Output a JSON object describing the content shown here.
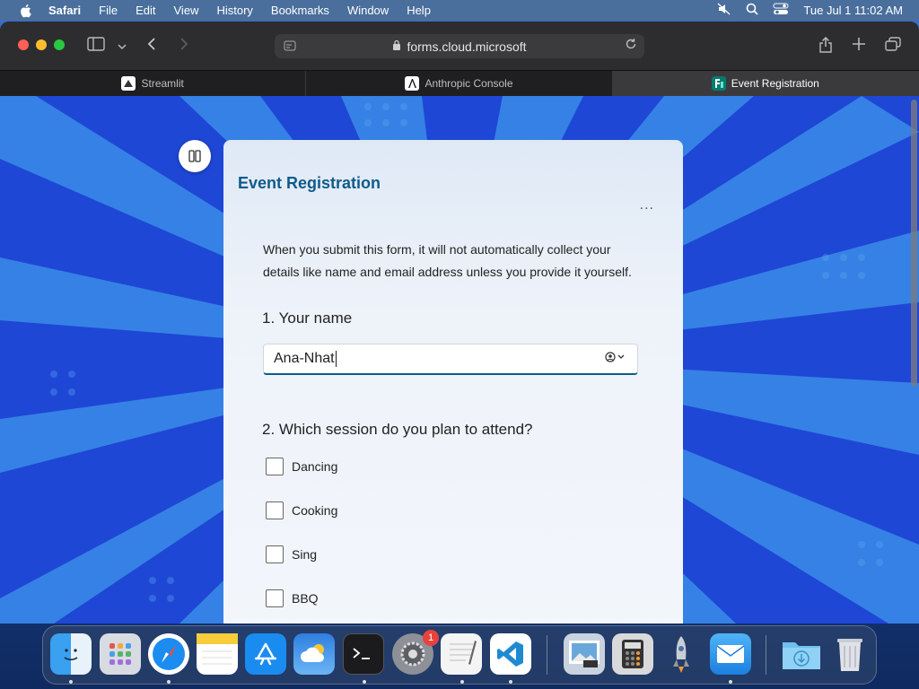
{
  "menubar": {
    "app_name": "Safari",
    "items": [
      "File",
      "Edit",
      "View",
      "History",
      "Bookmarks",
      "Window",
      "Help"
    ],
    "clock": "Tue Jul 1  11:02 AM"
  },
  "browser": {
    "url": "forms.cloud.microsoft",
    "tabs": [
      {
        "label": "Streamlit",
        "icon": "streamlit-icon"
      },
      {
        "label": "Anthropic Console",
        "icon": "anthropic-icon"
      },
      {
        "label": "Event Registration",
        "icon": "forms-icon"
      }
    ]
  },
  "form": {
    "title": "Event Registration",
    "more_label": "...",
    "description": "When you submit this form, it will not automatically collect your details like name and email address unless you provide it yourself.",
    "q1": {
      "number": "1.",
      "label": "Your name",
      "value": "Ana-Nhat"
    },
    "q2": {
      "number": "2.",
      "label": "Which session do you plan to attend?",
      "options": [
        "Dancing",
        "Cooking",
        "Sing",
        "BBQ"
      ]
    }
  },
  "dock": {
    "items": [
      "Finder",
      "Launchpad",
      "Safari",
      "Notes",
      "App Store",
      "Weather",
      "Terminal",
      "System Settings",
      "TextEdit",
      "Visual Studio Code",
      "Preview",
      "Calculator",
      "Rocket",
      "Mail",
      "Downloads",
      "Trash"
    ],
    "settings_badge": "1"
  },
  "colors": {
    "form_title": "#0f5a8c",
    "page_bg": "#1f4bd8",
    "accent": "#0f5a8c"
  }
}
